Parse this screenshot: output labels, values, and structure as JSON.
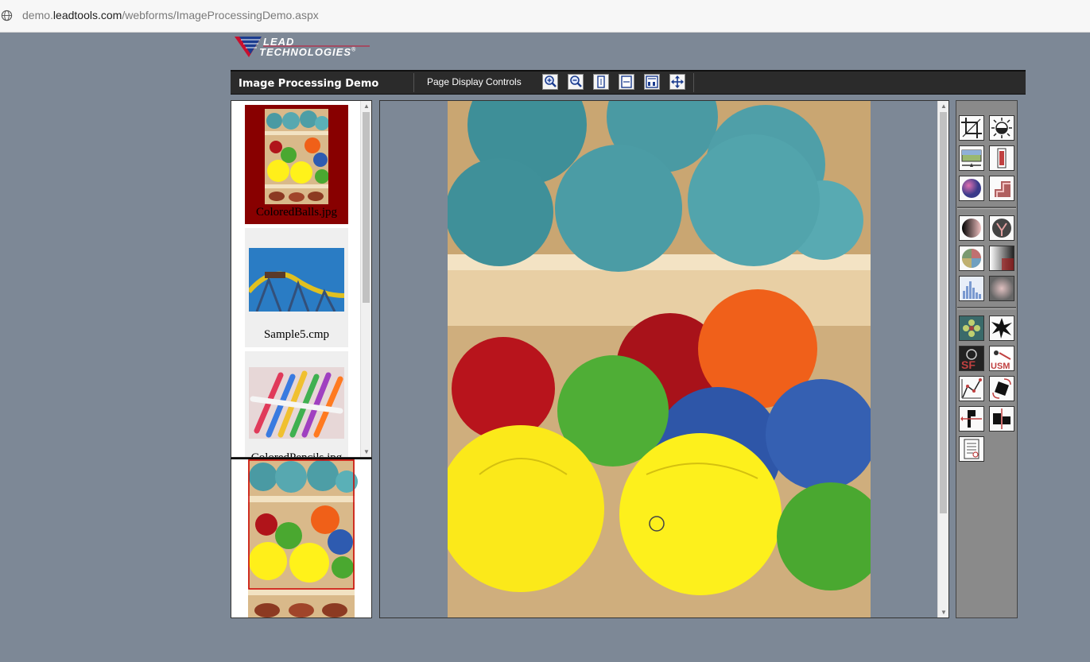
{
  "browser": {
    "url_prefix": "demo.",
    "url_host": "leadtools.com",
    "url_path": "/webforms/ImageProcessingDemo.aspx"
  },
  "logo": {
    "line1": "LEAD",
    "line2": "TECHNOLOGIES",
    "mark": "®"
  },
  "toolbar": {
    "title": "Image Processing Demo",
    "page_display_label": "Page Display Controls",
    "buttons": [
      "zoom-in-icon",
      "zoom-out-icon",
      "fit-page-icon",
      "fit-width-icon",
      "actual-size-icon",
      "pan-icon"
    ]
  },
  "thumbnails": [
    {
      "caption": "ColoredBalls.jpg",
      "selected": true
    },
    {
      "caption": "Sample5.cmp",
      "selected": false
    },
    {
      "caption": "ColoredPencils.jpg",
      "selected": false
    }
  ],
  "tool_groups": [
    [
      "crop-icon",
      "brightness-icon",
      "resize-icon",
      "deskew-icon",
      "color-sphere-icon",
      "emboss-icon"
    ],
    [
      "contrast-icon",
      "gamma-icon",
      "hue-icon",
      "gradient-icon",
      "histogram-icon",
      "blur-icon"
    ],
    [
      "sharpen-flower-icon",
      "star-burst-icon",
      "spatial-filter-icon",
      "unsharp-mask-icon",
      "curve-icon",
      "rotate-icon",
      "flip-icon",
      "mirror-icon",
      "document-icon"
    ]
  ],
  "tool_labels": {
    "spatial_filter": "SF",
    "unsharp_mask": "USM"
  },
  "colors": {
    "selected_thumb": "#880000",
    "toolbar_bg": "#2b2b2b",
    "page_bg": "#7d8896"
  }
}
